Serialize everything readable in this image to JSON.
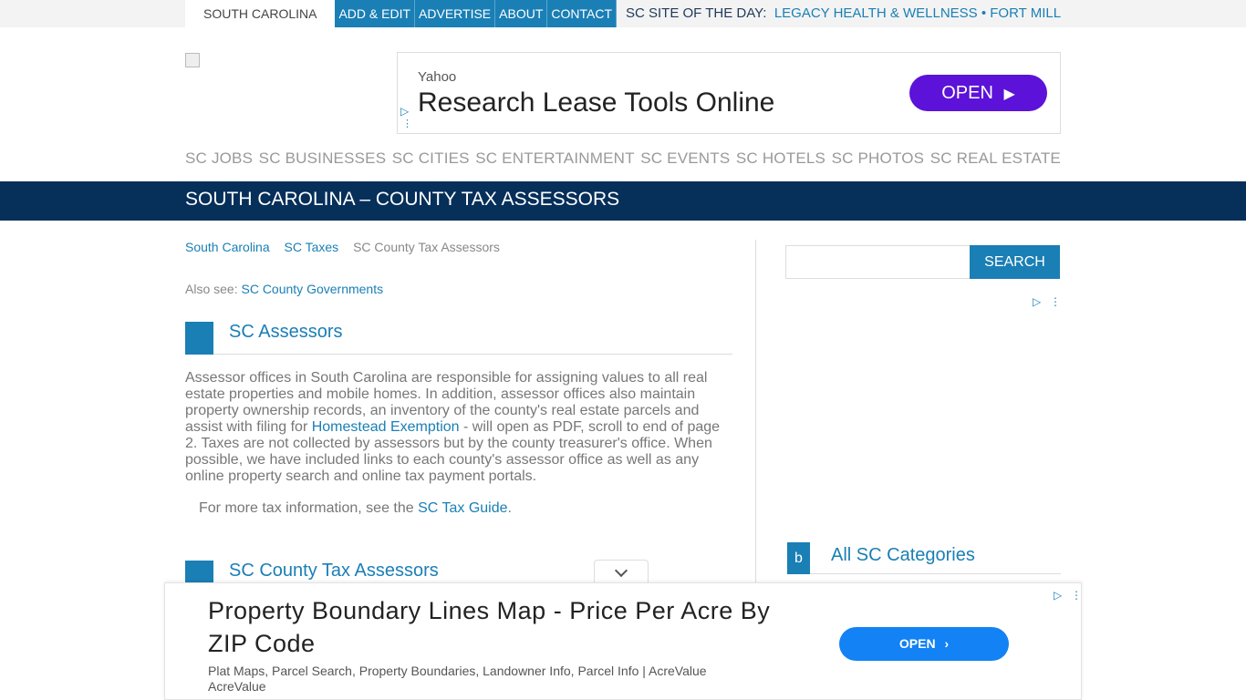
{
  "topbar": {
    "home_label": "SOUTH CAROLINA",
    "tabs": [
      "ADD & EDIT",
      "ADVERTISE",
      "ABOUT",
      "CONTACT"
    ],
    "site_of_day_label": "SC SITE OF THE DAY:",
    "site_of_day_link": "LEGACY HEALTH & WELLNESS • FORT MILL"
  },
  "ad_top": {
    "source": "Yahoo",
    "headline": "Research Lease Tools Online",
    "cta": "OPEN",
    "color": "#5c12d8"
  },
  "main_nav": [
    "SC JOBS",
    "SC BUSINESSES",
    "SC CITIES",
    "SC ENTERTAINMENT",
    "SC EVENTS",
    "SC HOTELS",
    "SC PHOTOS",
    "SC REAL ESTATE"
  ],
  "page_title": "SOUTH CAROLINA – COUNTY TAX ASSESSORS",
  "breadcrumb": {
    "items": [
      "South Carolina",
      "SC Taxes"
    ],
    "current": "SC County Tax Assessors"
  },
  "also_see": {
    "label": "Also see:",
    "link": "SC County Governments"
  },
  "section1": {
    "icon": "",
    "title": "SC Assessors",
    "text_before": "Assessor offices in South Carolina are responsible for assigning values to all real estate properties and mobile homes. In addition, assessor offices also maintain property ownership records, an inventory of the county's real estate parcels and assist with filing for ",
    "link": "Homestead Exemption",
    "text_after": " - will open as PDF, scroll to end of page 2. Taxes are not collected by assessors but by the county treasurer's office. When possible, we have included links to each county's assessor office as well as any online property search and online tax payment portals.",
    "more_before": "For more tax information, see the ",
    "more_link": "SC Tax Guide",
    "more_after": "."
  },
  "section2": {
    "icon": "",
    "title": "SC County Tax Assessors"
  },
  "sidebar": {
    "search_icon": "",
    "search_button": "SEARCH",
    "categories_icon": "b",
    "categories_title": "All SC Categories"
  },
  "ad_bottom": {
    "headline": "Property Boundary Lines Map - Price Per Acre By ZIP Code",
    "description": "Plat Maps, Parcel Search, Property Boundaries, Landowner Info, Parcel Info | AcreValue",
    "source": "AcreValue",
    "cta": "OPEN",
    "color": "#1282f4"
  },
  "colors": {
    "accent": "#1a7fb5",
    "title_bar": "#062f5a"
  }
}
